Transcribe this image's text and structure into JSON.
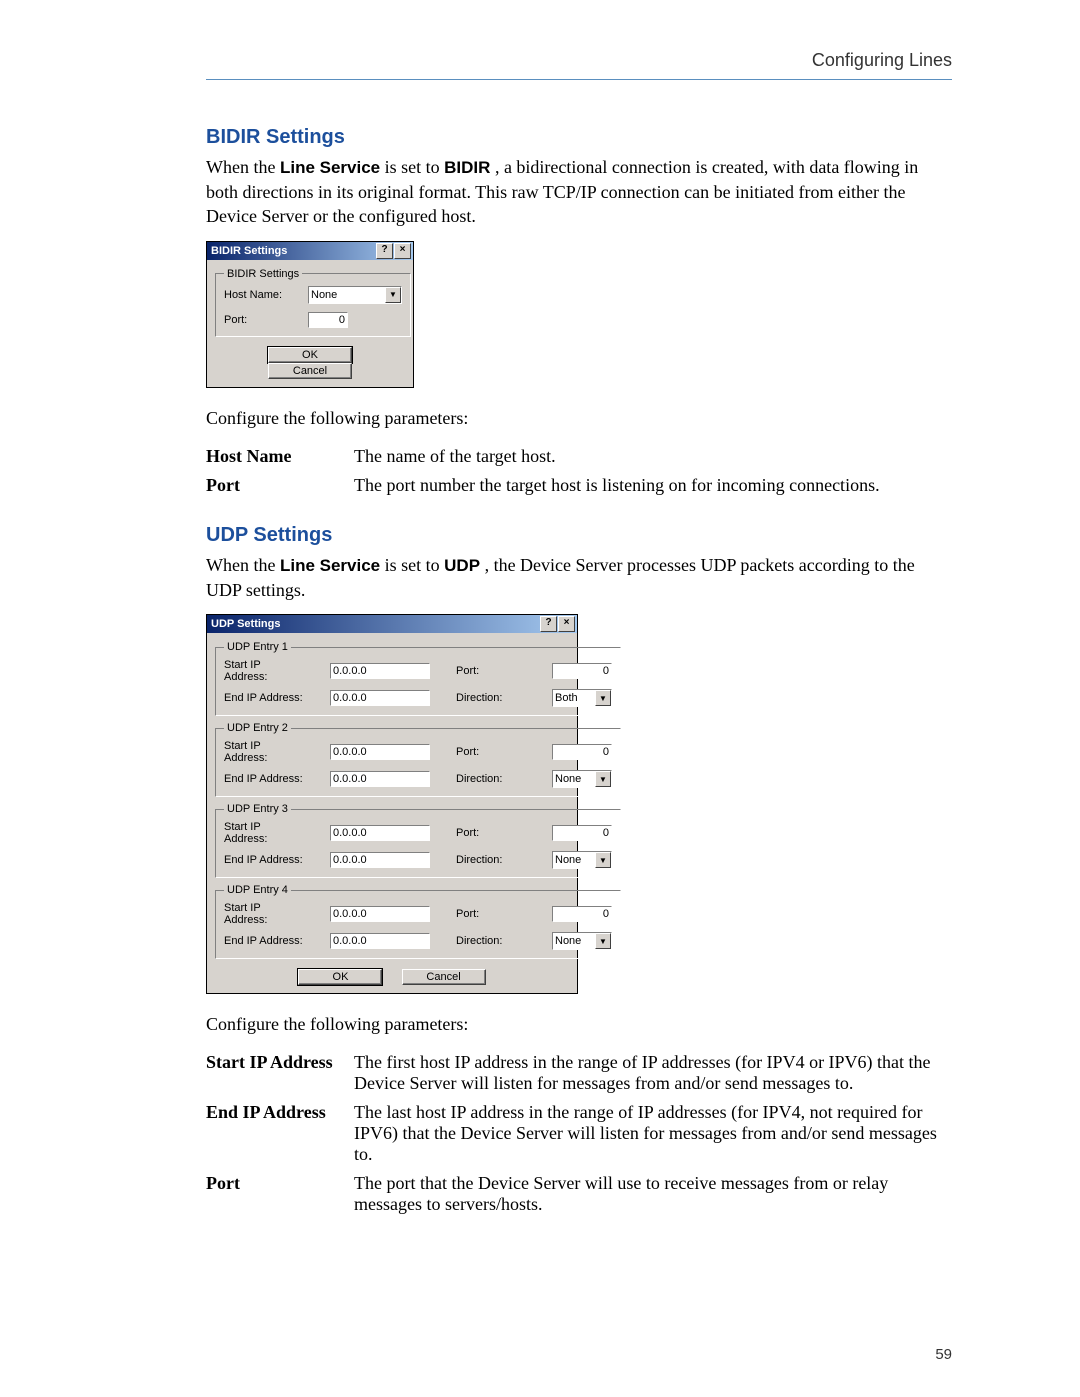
{
  "header": {
    "right": "Configuring Lines"
  },
  "page_number": "59",
  "bidir": {
    "title": "BIDIR Settings",
    "para_parts": {
      "p1a": "When the ",
      "p1_ls": "Line Service",
      "p1b": " is set to ",
      "p1_bd": "BIDIR",
      "p1c": ", a bidirectional connection is created, with data flowing in both directions in its original format. This raw TCP/IP connection can be initiated from either the Device Server or the configured host."
    },
    "dlg": {
      "title": "BIDIR Settings",
      "group": "BIDIR Settings",
      "host_label": "Host Name:",
      "host_value": "None",
      "port_label": "Port:",
      "port_value": "0",
      "ok": "OK",
      "cancel": "Cancel"
    },
    "configure_line": "Configure the following parameters:",
    "params": {
      "hostname_k": "Host Name",
      "hostname_v": "The name of the target host.",
      "port_k": "Port",
      "port_v": "The port number the target host is listening on for incoming connections."
    }
  },
  "udp": {
    "title": "UDP Settings",
    "para_parts": {
      "p1a": "When the ",
      "p1_ls": "Line Service",
      "p1b": " is set to ",
      "p1_udp": "UDP",
      "p1c": ", the Device Server processes UDP packets according to the UDP settings."
    },
    "dlg": {
      "title": "UDP Settings",
      "labels": {
        "start": "Start IP Address:",
        "end": "End IP Address:",
        "port": "Port:",
        "direction": "Direction:"
      },
      "entries": [
        {
          "legend": "UDP Entry 1",
          "start": "0.0.0.0",
          "end": "0.0.0.0",
          "port": "0",
          "direction": "Both"
        },
        {
          "legend": "UDP Entry 2",
          "start": "0.0.0.0",
          "end": "0.0.0.0",
          "port": "0",
          "direction": "None"
        },
        {
          "legend": "UDP Entry 3",
          "start": "0.0.0.0",
          "end": "0.0.0.0",
          "port": "0",
          "direction": "None"
        },
        {
          "legend": "UDP Entry 4",
          "start": "0.0.0.0",
          "end": "0.0.0.0",
          "port": "0",
          "direction": "None"
        }
      ],
      "ok": "OK",
      "cancel": "Cancel"
    },
    "configure_line": "Configure the following parameters:",
    "params": {
      "start_k": "Start IP Address",
      "start_v": "The first host IP address in the range of IP addresses (for IPV4 or IPV6) that the Device Server will listen for messages from and/or send messages to.",
      "end_k": "End IP Address",
      "end_v": "The last host IP address in the range of IP addresses (for IPV4, not required for IPV6) that the Device Server will listen for messages from and/or send messages to.",
      "port_k": "Port",
      "port_v": "The port that the Device Server will use to receive messages from or relay messages to servers/hosts."
    }
  }
}
